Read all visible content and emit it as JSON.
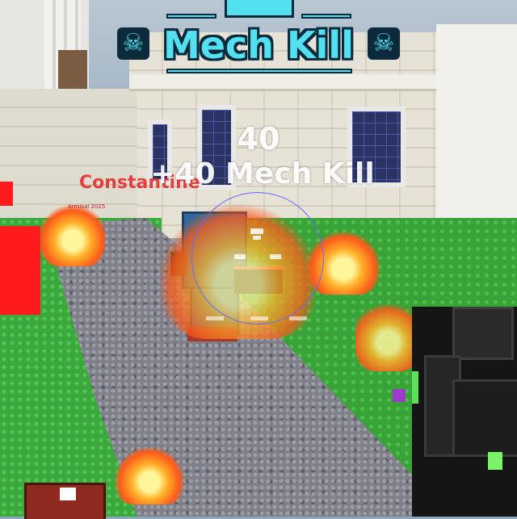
{
  "hud": {
    "banner_title": "Mech Kill",
    "score_popup": "40",
    "kill_message": "+40 Mech Kill",
    "enemy_name": "Constantine",
    "enemy_name_small": "Armisal 2025",
    "accent_color": "#53e1f2",
    "enemy_color": "#e72323"
  },
  "icons": {
    "banner_left": "skull-icon",
    "banner_right": "skull-icon",
    "crosshair": "crosshair-icon"
  }
}
